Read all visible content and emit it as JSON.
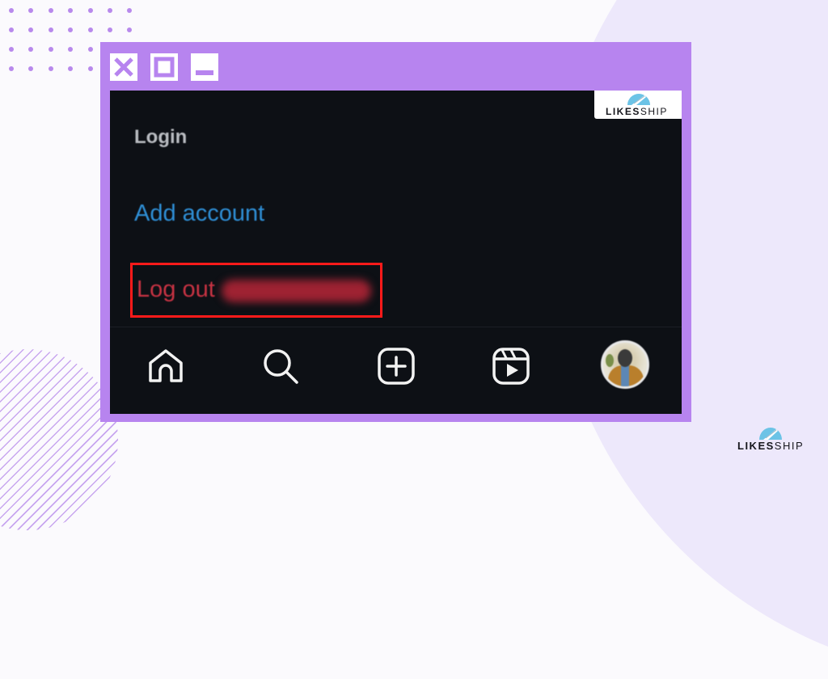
{
  "window": {
    "controls": [
      {
        "name": "close",
        "icon": "close-icon"
      },
      {
        "name": "maximize",
        "icon": "maximize-icon"
      },
      {
        "name": "minimize",
        "icon": "minimize-icon"
      }
    ],
    "frame_color": "#b784ef"
  },
  "watermark": {
    "brand_bold": "LIKES",
    "brand_thin": "SHIP",
    "icon": "ship-logo-icon"
  },
  "menu": {
    "items": [
      {
        "label": "Login",
        "color": "#b9bcc1"
      },
      {
        "label": "Add account",
        "color": "#2f8fd6"
      },
      {
        "label": "Log out",
        "color": "#c73343",
        "highlighted": true,
        "username": "(blurred)"
      }
    ],
    "highlight_color": "#ff1a1a"
  },
  "bottom_nav": {
    "items": [
      {
        "name": "home",
        "icon": "home-icon"
      },
      {
        "name": "search",
        "icon": "search-icon"
      },
      {
        "name": "create",
        "icon": "plus-square-icon"
      },
      {
        "name": "reels",
        "icon": "reels-icon"
      },
      {
        "name": "profile",
        "icon": "avatar"
      }
    ]
  },
  "corner_brand": {
    "brand_bold": "LIKES",
    "brand_thin": "SHIP"
  }
}
